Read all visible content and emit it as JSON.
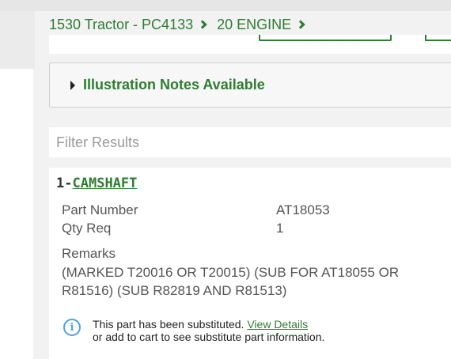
{
  "breadcrumb": {
    "items": [
      "1530 Tractor - PC4133",
      "20 ENGINE"
    ]
  },
  "illustration_notes": {
    "label": "Illustration Notes Available"
  },
  "filter": {
    "placeholder": "Filter Results"
  },
  "part": {
    "index": "1",
    "separator": "-",
    "name": "CAMSHAFT",
    "part_number_label": "Part Number",
    "part_number": "AT18053",
    "qty_label": "Qty Req",
    "qty": "1",
    "remarks_label": "Remarks",
    "remarks": "(MARKED T20016 OR T20015) (SUB FOR AT18055 OR R81516) (SUB R82819 AND R81513)",
    "substitution_text": "This part has been substituted.",
    "view_details": "View Details",
    "substitution_text2": "or add to cart to see substitute part information."
  },
  "icons": {
    "info": "info-circle-icon",
    "breadcrumb_separator": "chevron-right-icon",
    "expand": "caret-right-icon"
  },
  "colors": {
    "accent_green": "#2e7d32",
    "info_blue": "#4aa3df"
  }
}
